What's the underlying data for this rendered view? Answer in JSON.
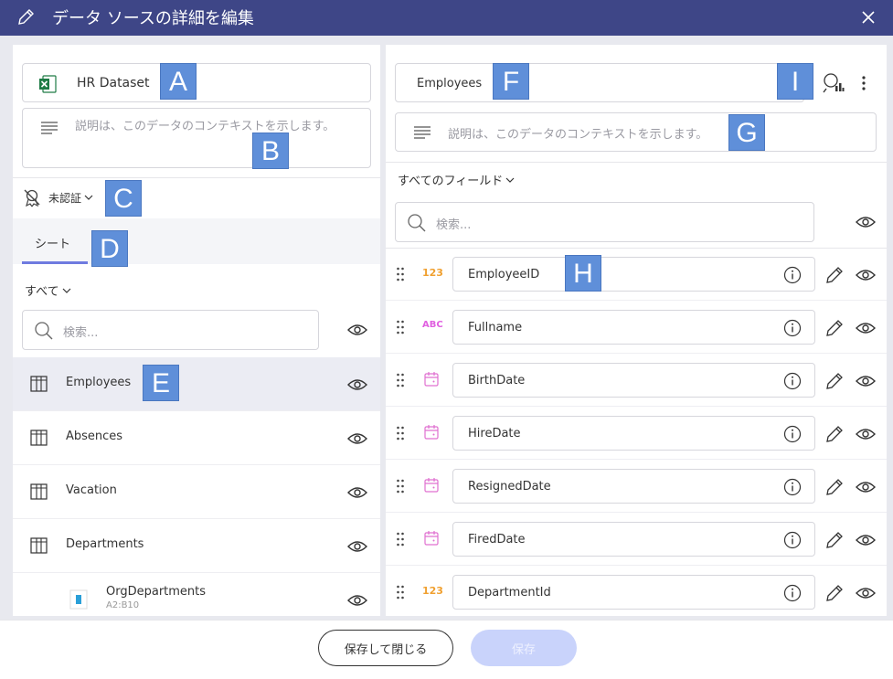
{
  "dialog": {
    "title": "データ ソースの詳細を編集"
  },
  "left": {
    "dataset_name": "HR Dataset",
    "description_placeholder": "説明は、このデータのコンテキストを示します。",
    "certification": "未認証",
    "tab_label": "シート",
    "filter_label": "すべて",
    "search_placeholder": "検索...",
    "sheets": [
      {
        "label": "Employees",
        "selected": true
      },
      {
        "label": "Absences"
      },
      {
        "label": "Vacation"
      },
      {
        "label": "Departments"
      }
    ],
    "sub_sheet": {
      "label": "OrgDepartments",
      "range": "A2:B10"
    }
  },
  "right": {
    "table_name": "Employees",
    "description_placeholder": "説明は、このデータのコンテキストを示します。",
    "fields_filter": "すべてのフィールド",
    "search_placeholder": "検索...",
    "fields": [
      {
        "name": "EmployeeID",
        "type": "number",
        "type_label": "123"
      },
      {
        "name": "Fullname",
        "type": "text",
        "type_label": "ABC"
      },
      {
        "name": "BirthDate",
        "type": "date",
        "type_label": ""
      },
      {
        "name": "HireDate",
        "type": "date",
        "type_label": ""
      },
      {
        "name": "ResignedDate",
        "type": "date",
        "type_label": ""
      },
      {
        "name": "FiredDate",
        "type": "date",
        "type_label": ""
      },
      {
        "name": "DepartmentId",
        "type": "number",
        "type_label": "123"
      }
    ]
  },
  "footer": {
    "save_close_label": "保存して閉じる",
    "save_label": "保存"
  },
  "markers": {
    "A": "A",
    "B": "B",
    "C": "C",
    "D": "D",
    "E": "E",
    "F": "F",
    "G": "G",
    "H": "H",
    "I": "I"
  },
  "colors": {
    "header": "#3e4687",
    "accent": "#6f7be0",
    "number_type": "#f0a030",
    "text_type": "#e060e0",
    "date_type": "#e070d0",
    "excel": "#1e7b45",
    "marker": "#5f8fd9"
  }
}
